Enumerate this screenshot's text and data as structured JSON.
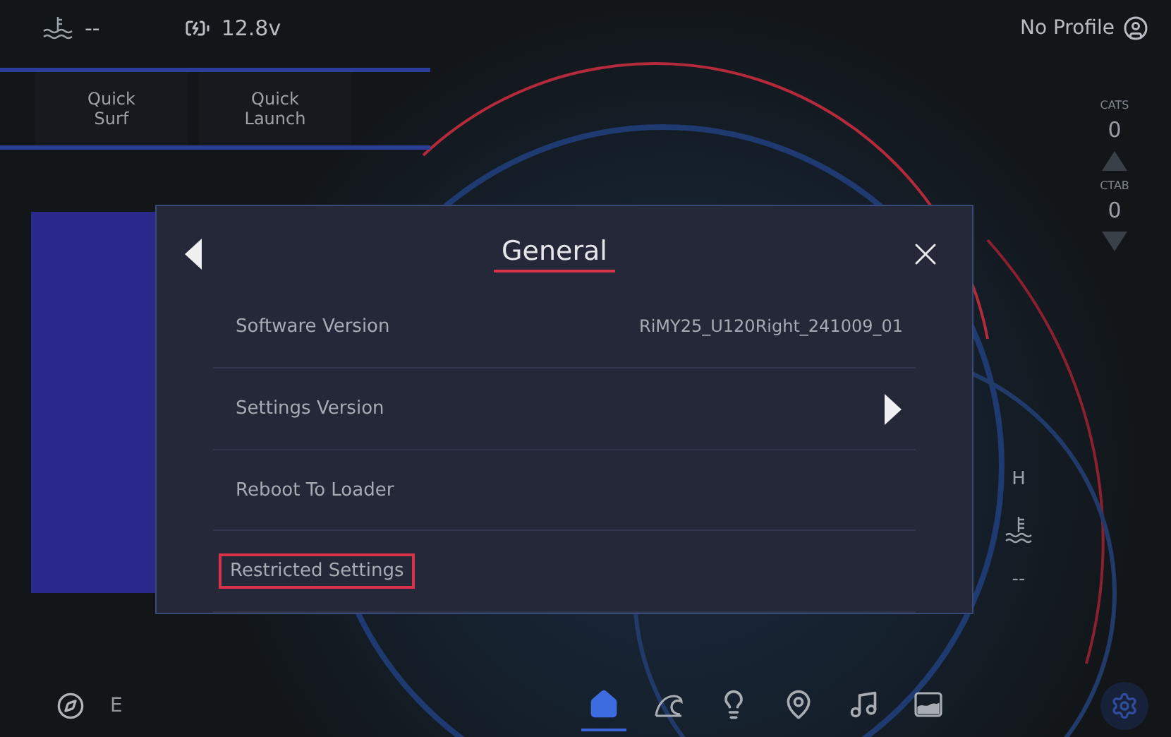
{
  "status_bar": {
    "water_temp": "--",
    "battery": "12.8v",
    "profile": "No Profile"
  },
  "quick_buttons": [
    {
      "label": "Quick Surf"
    },
    {
      "label": "Quick Launch"
    }
  ],
  "counters": [
    {
      "label": "CATS",
      "value": "0"
    },
    {
      "label": "CTAB",
      "value": "0"
    }
  ],
  "gauge": {
    "mark": "H",
    "engine_temp": "--"
  },
  "dialog": {
    "title": "General",
    "rows": [
      {
        "label": "Software Version",
        "kind": "value",
        "value": "RiMY25_U120Right_241009_01",
        "selected": false
      },
      {
        "label": "Settings Version",
        "kind": "arrow",
        "selected": false
      },
      {
        "label": "Reboot To Loader",
        "kind": "plain",
        "selected": false
      },
      {
        "label": "Restricted Settings",
        "kind": "plain",
        "selected": true
      }
    ]
  },
  "bottom_bar": {
    "heading": "E",
    "nav": [
      {
        "kind": "home",
        "selected": true
      },
      {
        "kind": "wave",
        "selected": false
      },
      {
        "kind": "light",
        "selected": false
      },
      {
        "kind": "location",
        "selected": false
      },
      {
        "kind": "music",
        "selected": false
      },
      {
        "kind": "ballast",
        "selected": false
      }
    ]
  }
}
